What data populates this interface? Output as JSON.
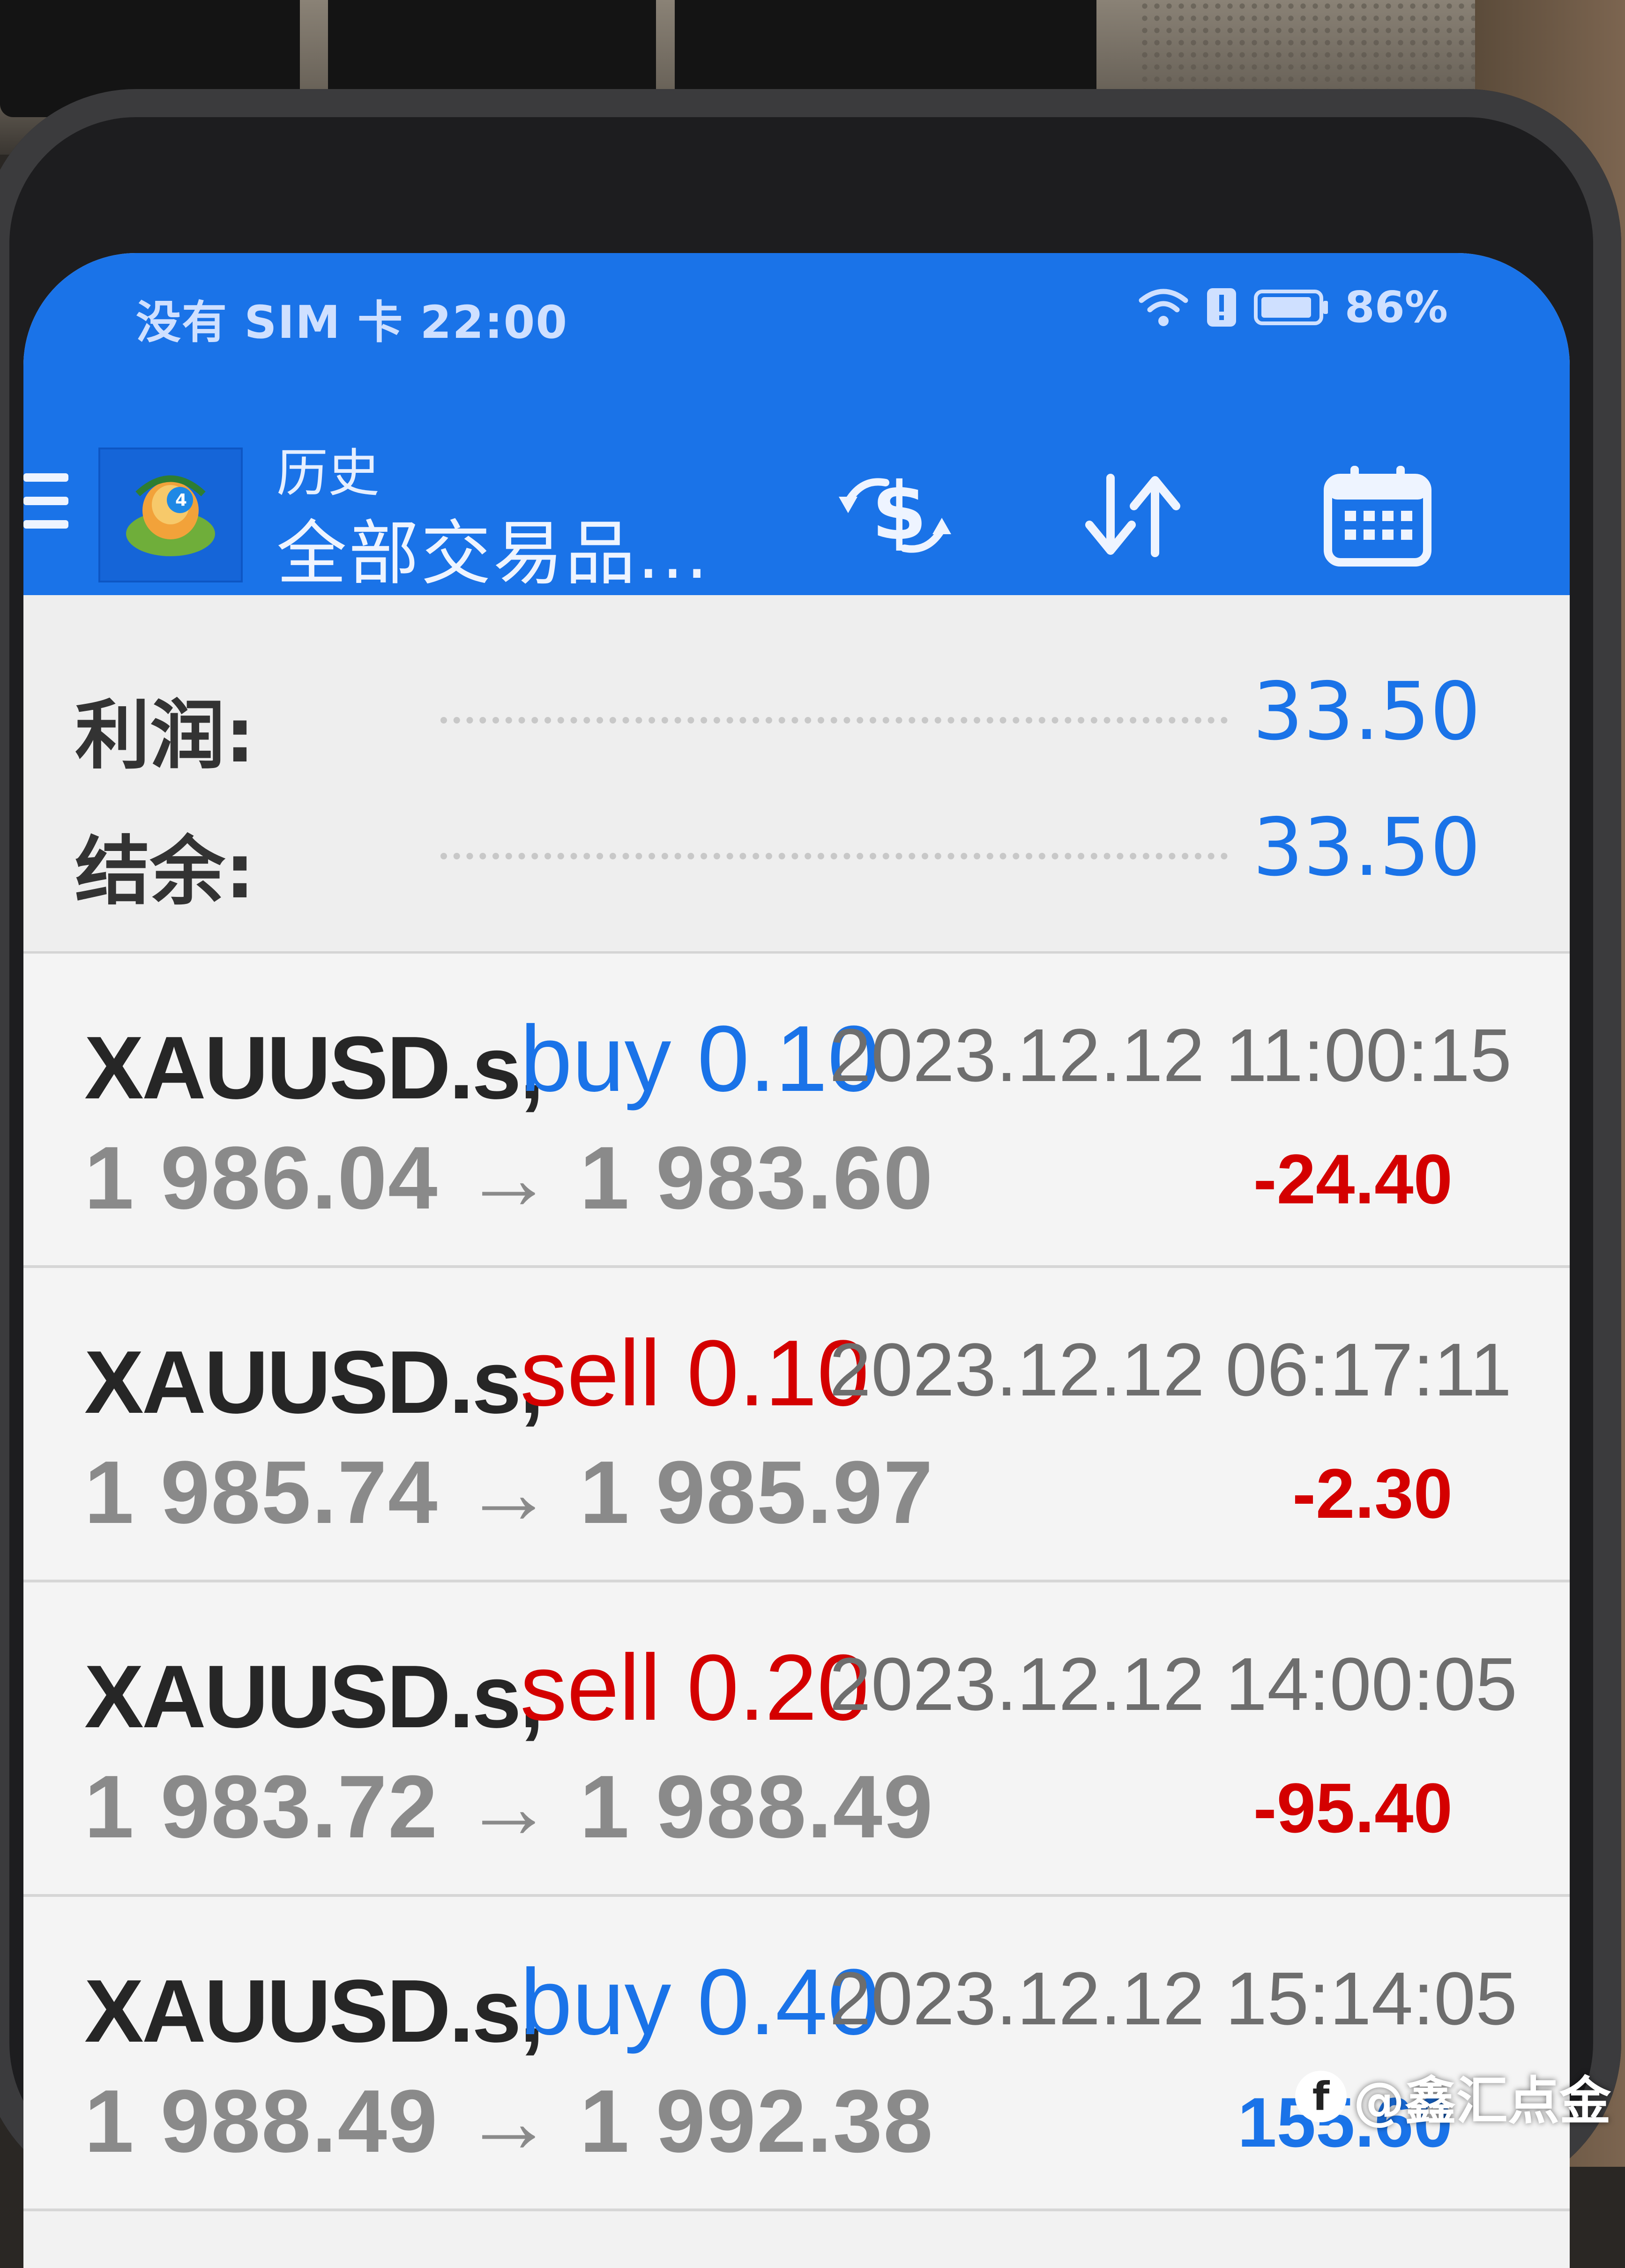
{
  "status_bar": {
    "left_text": "没有 SIM 卡 22:00",
    "battery": "86%"
  },
  "app_bar": {
    "title": "历史",
    "subtitle": "全部交易品..."
  },
  "summary": {
    "profit_label": "利润:",
    "profit_value": "33.50",
    "balance_label": "结余:",
    "balance_value": "33.50"
  },
  "deals": [
    {
      "symbol": "XAUUSD.s,",
      "side": "buy 0.10",
      "side_type": "buy",
      "time": "2023.12.12 11:00:15",
      "prices": "1 986.04 → 1 983.60",
      "profit": "-24.40",
      "profit_type": "loss"
    },
    {
      "symbol": "XAUUSD.s,",
      "side": "sell 0.10",
      "side_type": "sell",
      "time": "2023.12.12 06:17:11",
      "prices": "1 985.74 → 1 985.97",
      "profit": "-2.30",
      "profit_type": "loss"
    },
    {
      "symbol": "XAUUSD.s,",
      "side": "sell 0.20",
      "side_type": "sell",
      "time": "2023.12.12 14:00:05",
      "prices": "1 983.72 → 1 988.49",
      "profit": "-95.40",
      "profit_type": "loss"
    },
    {
      "symbol": "XAUUSD.s,",
      "side": "buy 0.40",
      "side_type": "buy",
      "time": "2023.12.12 15:14:05",
      "prices": "1 988.49 → 1 992.38",
      "profit": "155.60",
      "profit_type": "gain"
    }
  ],
  "icons": {
    "menu": "hamburger-menu-icon",
    "logo": "metatrader4-logo",
    "currency": "dollar-exchange-icon",
    "sort": "sort-arrows-icon",
    "calendar": "calendar-icon",
    "wifi": "wifi-icon",
    "battery": "battery-icon"
  },
  "colors": {
    "header_blue": "#1a73e8",
    "buy_blue": "#1a73e8",
    "sell_red": "#d40000",
    "price_gray": "#8a8a8a"
  },
  "watermark": {
    "text": "@鑫汇点金"
  }
}
